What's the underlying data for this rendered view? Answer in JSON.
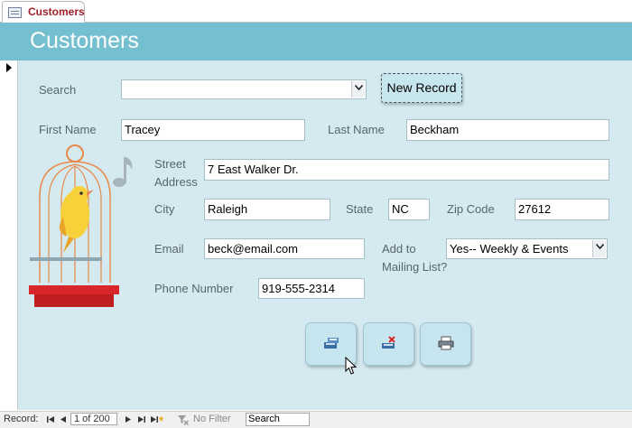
{
  "document_tab": {
    "label": "Customers",
    "icon": "form-icon"
  },
  "form": {
    "title": "Customers"
  },
  "search": {
    "label": "Search",
    "value": ""
  },
  "new_record_button": {
    "label": "New Record"
  },
  "fields": {
    "first_name": {
      "label": "First Name",
      "value": "Tracey"
    },
    "last_name": {
      "label": "Last Name",
      "value": "Beckham"
    },
    "street_address": {
      "label_line1": "Street",
      "label_line2": "Address",
      "value": "7 East Walker Dr."
    },
    "city": {
      "label": "City",
      "value": "Raleigh"
    },
    "state": {
      "label": "State",
      "value": "NC"
    },
    "zip": {
      "label": "Zip Code",
      "value": "27612"
    },
    "email": {
      "label": "Email",
      "value": "beck@email.com"
    },
    "mailing_list": {
      "label_line1": "Add to",
      "label_line2": "Mailing List?",
      "value": "Yes-- Weekly & Events"
    },
    "phone": {
      "label": "Phone Number",
      "value": "919-555-2314"
    }
  },
  "action_buttons": [
    {
      "name": "save-record-button",
      "icon": "save-record-icon"
    },
    {
      "name": "delete-record-button",
      "icon": "delete-record-icon"
    },
    {
      "name": "print-record-button",
      "icon": "printer-icon"
    }
  ],
  "navigation": {
    "record_label": "Record:",
    "position": "1 of 200",
    "filter_status": "No Filter",
    "search_placeholder": "Search"
  },
  "colors": {
    "header": "#74c0d0",
    "form_background": "#d4eaf0",
    "tab_title": "#a0202a",
    "label": "#59656c"
  }
}
